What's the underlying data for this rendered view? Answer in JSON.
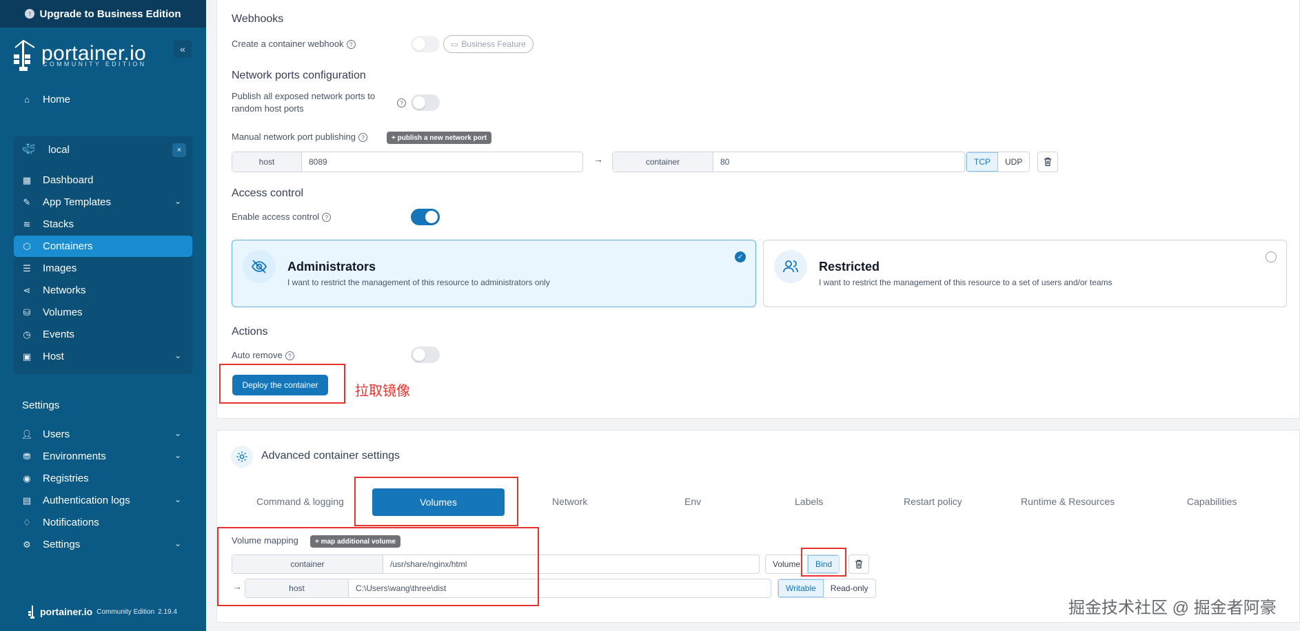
{
  "sidebar": {
    "upgrade_label": "Upgrade to Business Edition",
    "logo_text": "portainer.io",
    "logo_sub": "COMMUNITY EDITION",
    "collapse_icon": "«",
    "home_label": "Home",
    "environment": {
      "name": "local",
      "close": "×"
    },
    "env_items": [
      {
        "label": "Dashboard",
        "icon": "dashboard-icon"
      },
      {
        "label": "App Templates",
        "icon": "templates-icon",
        "has_chevron": true
      },
      {
        "label": "Stacks",
        "icon": "stacks-icon"
      },
      {
        "label": "Containers",
        "icon": "containers-icon",
        "active": true
      },
      {
        "label": "Images",
        "icon": "images-icon"
      },
      {
        "label": "Networks",
        "icon": "networks-icon"
      },
      {
        "label": "Volumes",
        "icon": "volumes-icon"
      },
      {
        "label": "Events",
        "icon": "events-icon"
      },
      {
        "label": "Host",
        "icon": "host-icon",
        "has_chevron": true
      }
    ],
    "settings_title": "Settings",
    "settings_items": [
      {
        "label": "Users",
        "has_chevron": true
      },
      {
        "label": "Environments",
        "has_chevron": true
      },
      {
        "label": "Registries"
      },
      {
        "label": "Authentication logs",
        "has_chevron": true
      },
      {
        "label": "Notifications"
      },
      {
        "label": "Settings",
        "has_chevron": true
      }
    ],
    "footer": {
      "logo_text": "portainer.io",
      "edition": "Community Edition",
      "version": "2.19.4"
    }
  },
  "webhooks": {
    "title": "Webhooks",
    "label": "Create a container webhook",
    "badge": "Business Feature"
  },
  "network_ports": {
    "title": "Network ports configuration",
    "publish_label_1": "Publish all exposed network ports to",
    "publish_label_2": "random host ports",
    "manual_label": "Manual network port publishing",
    "add_btn": "+ publish a new network port",
    "host_prefix": "host",
    "host_value": "8089",
    "arrow": "→",
    "container_prefix": "container",
    "container_value": "80",
    "protocols": [
      "TCP",
      "UDP"
    ]
  },
  "access_control": {
    "title": "Access control",
    "label": "Enable access control",
    "enabled": true,
    "admin": {
      "title": "Administrators",
      "desc": "I want to restrict the management of this resource to administrators only"
    },
    "restricted": {
      "title": "Restricted",
      "desc": "I want to restrict the management of this resource to a set of users and/or teams"
    }
  },
  "actions": {
    "title": "Actions",
    "auto_remove": "Auto remove",
    "deploy_label": "Deploy the container",
    "annotation": "拉取镜像"
  },
  "advanced": {
    "title": "Advanced container settings",
    "tabs": [
      "Command & logging",
      "Volumes",
      "Network",
      "Env",
      "Labels",
      "Restart policy",
      "Runtime & Resources",
      "Capabilities"
    ],
    "active_tab": "Volumes"
  },
  "volumes": {
    "mapping_label": "Volume mapping",
    "add_btn": "+ map additional volume",
    "container_prefix": "container",
    "container_value": "/usr/share/nginx/html",
    "type_options": [
      "Volume",
      "Bind"
    ],
    "arrow": "→",
    "host_prefix": "host",
    "host_value": "C:\\Users\\wang\\three\\dist",
    "mode_options": [
      "Writable",
      "Read-only"
    ]
  },
  "watermark": "掘金技术社区 @ 掘金者阿豪",
  "colors": {
    "sidebar": "#0a5a85",
    "accent": "#1576ba",
    "annotation": "#e5322d"
  }
}
